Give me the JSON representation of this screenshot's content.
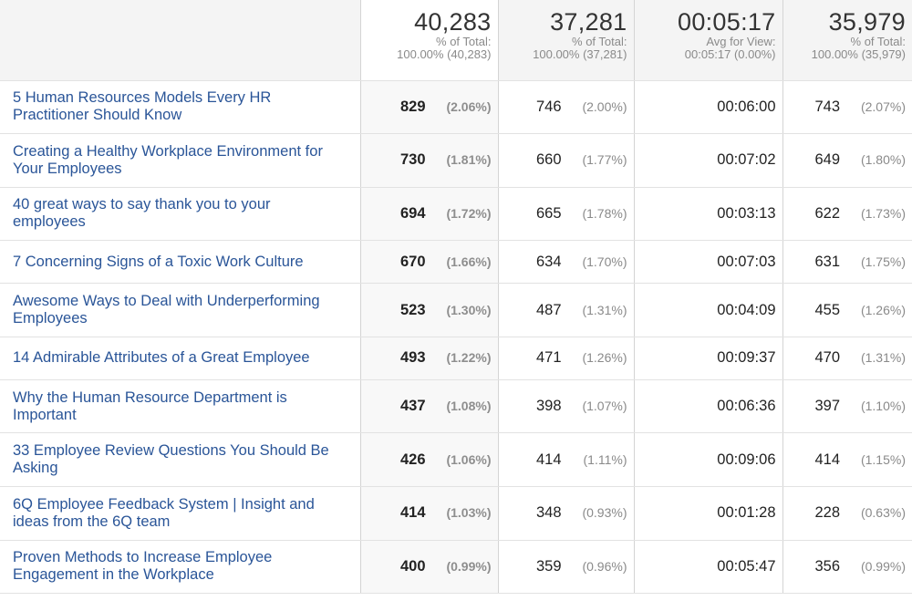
{
  "summary": [
    {
      "total": "40,283",
      "label": "% of Total:",
      "detail": "100.00% (40,283)"
    },
    {
      "total": "37,281",
      "label": "% of Total:",
      "detail": "100.00% (37,281)"
    },
    {
      "total": "00:05:17",
      "label": "Avg for View:",
      "detail": "00:05:17 (0.00%)"
    },
    {
      "total": "35,979",
      "label": "% of Total:",
      "detail": "100.00% (35,979)"
    }
  ],
  "rows": [
    {
      "title": "5 Human Resources Models Every HR Practitioner Should Know",
      "m1": "829",
      "m1_pct": "(2.06%)",
      "m2": "746",
      "m2_pct": "(2.00%)",
      "m3": "00:06:00",
      "m4": "743",
      "m4_pct": "(2.07%)"
    },
    {
      "title": "Creating a Healthy Workplace Environment for Your Employees",
      "m1": "730",
      "m1_pct": "(1.81%)",
      "m2": "660",
      "m2_pct": "(1.77%)",
      "m3": "00:07:02",
      "m4": "649",
      "m4_pct": "(1.80%)"
    },
    {
      "title": "40 great ways to say thank you to your employees",
      "m1": "694",
      "m1_pct": "(1.72%)",
      "m2": "665",
      "m2_pct": "(1.78%)",
      "m3": "00:03:13",
      "m4": "622",
      "m4_pct": "(1.73%)"
    },
    {
      "title": "7 Concerning Signs of a Toxic Work Culture",
      "m1": "670",
      "m1_pct": "(1.66%)",
      "m2": "634",
      "m2_pct": "(1.70%)",
      "m3": "00:07:03",
      "m4": "631",
      "m4_pct": "(1.75%)"
    },
    {
      "title": "Awesome Ways to Deal with Underperforming Employees",
      "m1": "523",
      "m1_pct": "(1.30%)",
      "m2": "487",
      "m2_pct": "(1.31%)",
      "m3": "00:04:09",
      "m4": "455",
      "m4_pct": "(1.26%)"
    },
    {
      "title": "14 Admirable Attributes of a Great Employee",
      "m1": "493",
      "m1_pct": "(1.22%)",
      "m2": "471",
      "m2_pct": "(1.26%)",
      "m3": "00:09:37",
      "m4": "470",
      "m4_pct": "(1.31%)"
    },
    {
      "title": "Why the Human Resource Department is Important",
      "m1": "437",
      "m1_pct": "(1.08%)",
      "m2": "398",
      "m2_pct": "(1.07%)",
      "m3": "00:06:36",
      "m4": "397",
      "m4_pct": "(1.10%)"
    },
    {
      "title": "33 Employee Review Questions You Should Be Asking",
      "m1": "426",
      "m1_pct": "(1.06%)",
      "m2": "414",
      "m2_pct": "(1.11%)",
      "m3": "00:09:06",
      "m4": "414",
      "m4_pct": "(1.15%)"
    },
    {
      "title": "6Q Employee Feedback System | Insight and ideas from the 6Q team",
      "m1": "414",
      "m1_pct": "(1.03%)",
      "m2": "348",
      "m2_pct": "(0.93%)",
      "m3": "00:01:28",
      "m4": "228",
      "m4_pct": "(0.63%)"
    },
    {
      "title": "Proven Methods to Increase Employee Engagement in the Workplace",
      "m1": "400",
      "m1_pct": "(0.99%)",
      "m2": "359",
      "m2_pct": "(0.96%)",
      "m3": "00:05:47",
      "m4": "356",
      "m4_pct": "(0.99%)"
    }
  ]
}
